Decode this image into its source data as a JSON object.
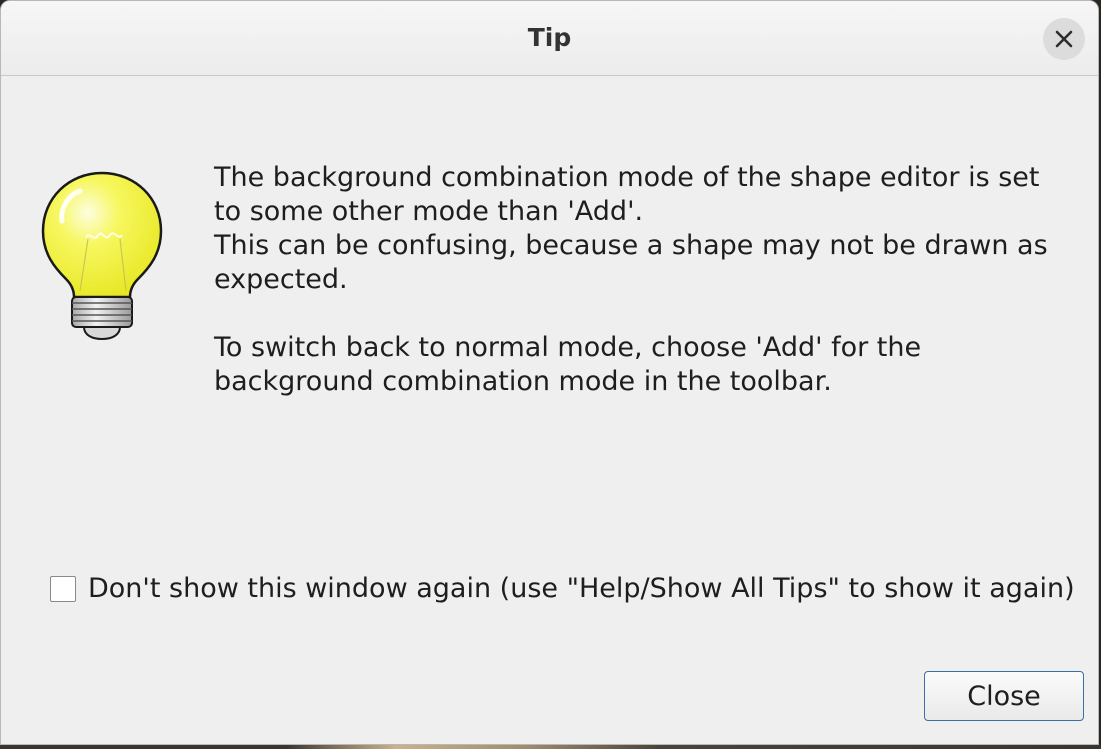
{
  "window": {
    "title": "Tip",
    "close_icon": "close-x-icon"
  },
  "tip": {
    "icon": "lightbulb-icon",
    "lines": [
      "The background combination mode of the shape editor is set",
      "to some other mode than 'Add'.",
      "This can be confusing, because a shape may not be drawn as",
      "expected."
    ],
    "lines2": [
      "To switch back to normal mode, choose 'Add' for the",
      "background combination mode in the toolbar."
    ]
  },
  "dont_show": {
    "label": "Don't show this window again (use \"Help/Show All Tips\" to show it again)",
    "checked": false
  },
  "buttons": {
    "close_label": "Close"
  },
  "colors": {
    "accent_border": "#3c6fa8",
    "bulb_yellow": "#f2f23a"
  }
}
